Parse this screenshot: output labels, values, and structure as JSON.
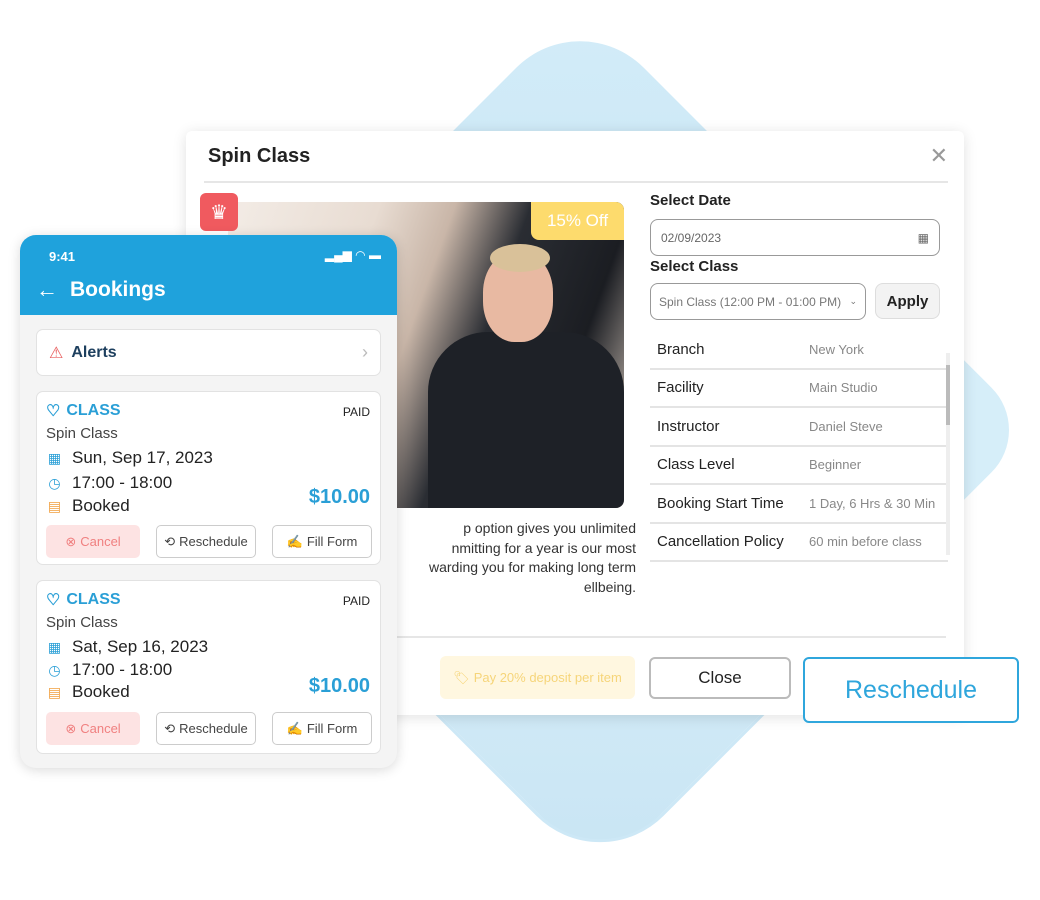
{
  "colors": {
    "accent": "#1fa2dc",
    "badge": "#fddb6d",
    "crown": "#f05a5f"
  },
  "modal": {
    "title": "Spin Class",
    "discount_badge": "15% Off",
    "description": "p option gives you unlimited\nnmitting for a year is our most\nwarding you for making long term\nellbeing.",
    "select_date_label": "Select Date",
    "date_value": "02/09/2023",
    "select_class_label": "Select Class",
    "class_value": "Spin Class (12:00 PM - 01:00 PM)",
    "apply": "Apply",
    "details": [
      {
        "k": "Branch",
        "v": "New York"
      },
      {
        "k": "Facility",
        "v": "Main Studio"
      },
      {
        "k": "Instructor",
        "v": "Daniel Steve"
      },
      {
        "k": "Class Level",
        "v": "Beginner"
      },
      {
        "k": "Booking Start Time",
        "v": "1 Day, 6 Hrs & 30 Min"
      },
      {
        "k": "Cancellation Policy",
        "v": "60 min before class"
      }
    ],
    "deposit": "Pay 20% deposit per item",
    "close": "Close",
    "reschedule": "Reschedule"
  },
  "phone": {
    "time": "9:41",
    "title": "Bookings",
    "alerts": "Alerts",
    "bookings": [
      {
        "type": "CLASS",
        "status": "PAID",
        "name": "Spin Class",
        "date": "Sun, Sep 17, 2023",
        "time": "17:00 - 18:00",
        "state": "Booked",
        "price": "$10.00",
        "cancel": "Cancel",
        "reschedule": "Reschedule",
        "fill": "Fill Form"
      },
      {
        "type": "CLASS",
        "status": "PAID",
        "name": "Spin Class",
        "date": "Sat, Sep 16, 2023",
        "time": "17:00 - 18:00",
        "state": "Booked",
        "price": "$10.00",
        "cancel": "Cancel",
        "reschedule": "Reschedule",
        "fill": "Fill Form"
      }
    ]
  }
}
